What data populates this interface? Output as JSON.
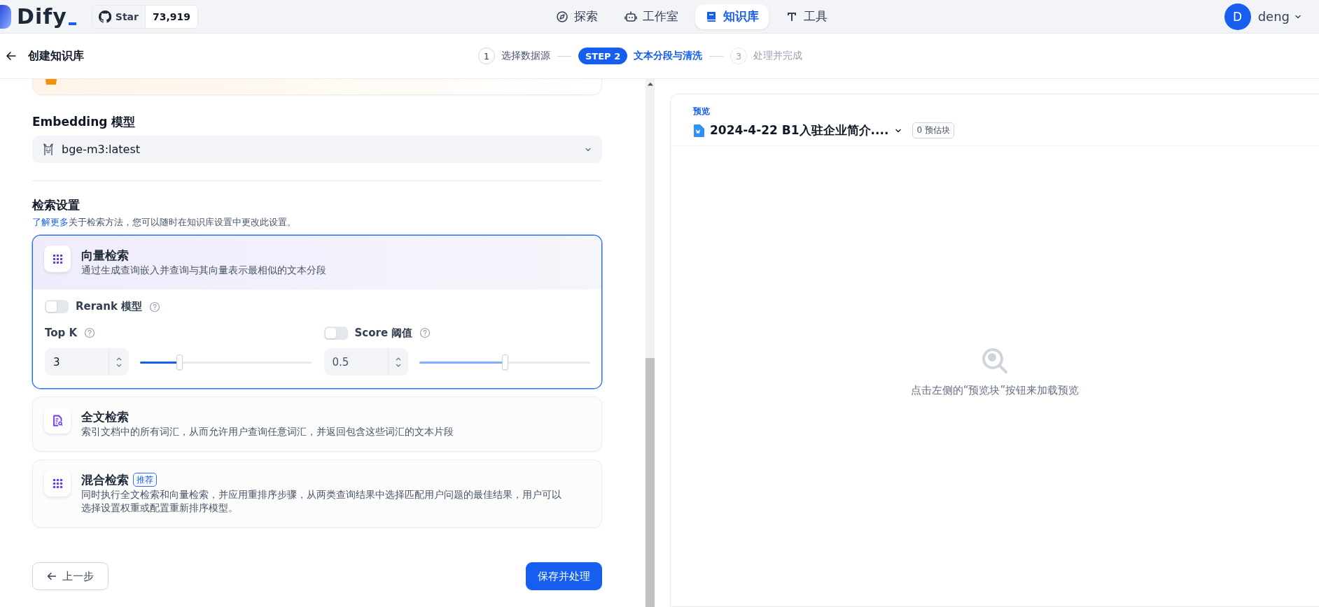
{
  "top_nav": {
    "logo": "Dify",
    "github": {
      "label": "Star",
      "count": "73,919"
    },
    "tabs": [
      {
        "kind": "explore",
        "label": "探索",
        "selected": false
      },
      {
        "kind": "studio",
        "label": "工作室",
        "selected": false
      },
      {
        "kind": "knowledge",
        "label": "知识库",
        "selected": true
      },
      {
        "kind": "tools",
        "label": "工具",
        "selected": false
      }
    ],
    "user": {
      "initial": "D",
      "name": "deng"
    }
  },
  "header": {
    "title": "创建知识库",
    "steps": [
      {
        "number": "1",
        "label": "选择数据源",
        "selected": false,
        "disabled": false
      },
      {
        "number": "STEP 2",
        "label": "文本分段与清洗",
        "selected": true,
        "disabled": false
      },
      {
        "number": "3",
        "label": "处理并完成",
        "selected": false,
        "disabled": true
      }
    ]
  },
  "settings": {
    "embedding": {
      "label": "Embedding 模型",
      "value": "bge-m3:latest"
    },
    "retrieval": {
      "title": "检索设置",
      "link": "了解更多",
      "description": "关于检索方法，您可以随时在知识库设置中更改此设置。",
      "methods": [
        {
          "kind": "vector",
          "title": "向量检索",
          "description": "通过生成查询嵌入并查询与其向量表示最相似的文本分段",
          "selected": true,
          "rerank": {
            "label": "Rerank 模型",
            "on": false
          },
          "top_k": {
            "label": "Top K",
            "value": "3",
            "level": 0.23
          },
          "score": {
            "label": "Score 阈值",
            "on": false,
            "value": "0.5",
            "level": 0.5
          }
        },
        {
          "kind": "fulltext",
          "title": "全文检索",
          "description": "索引文档中的所有词汇，从而允许用户查询任意词汇，并返回包含这些词汇的文本片段",
          "selected": false
        },
        {
          "kind": "hybrid",
          "title": "混合检索",
          "badge": "推荐",
          "description": "同时执行全文检索和向量检索，并应用重排序步骤，从两类查询结果中选择匹配用户问题的最佳结果，用户可以选择设置权重或配置重新排序模型。",
          "selected": false
        }
      ]
    }
  },
  "actions": {
    "back": "上一步",
    "save": "保存并处理"
  },
  "preview": {
    "label": "预览",
    "file": "2024-4-22 B1入驻企业简介....",
    "count": "0 预估块",
    "empty_text": "点击左侧的“预览块”按钮来加载预览"
  }
}
